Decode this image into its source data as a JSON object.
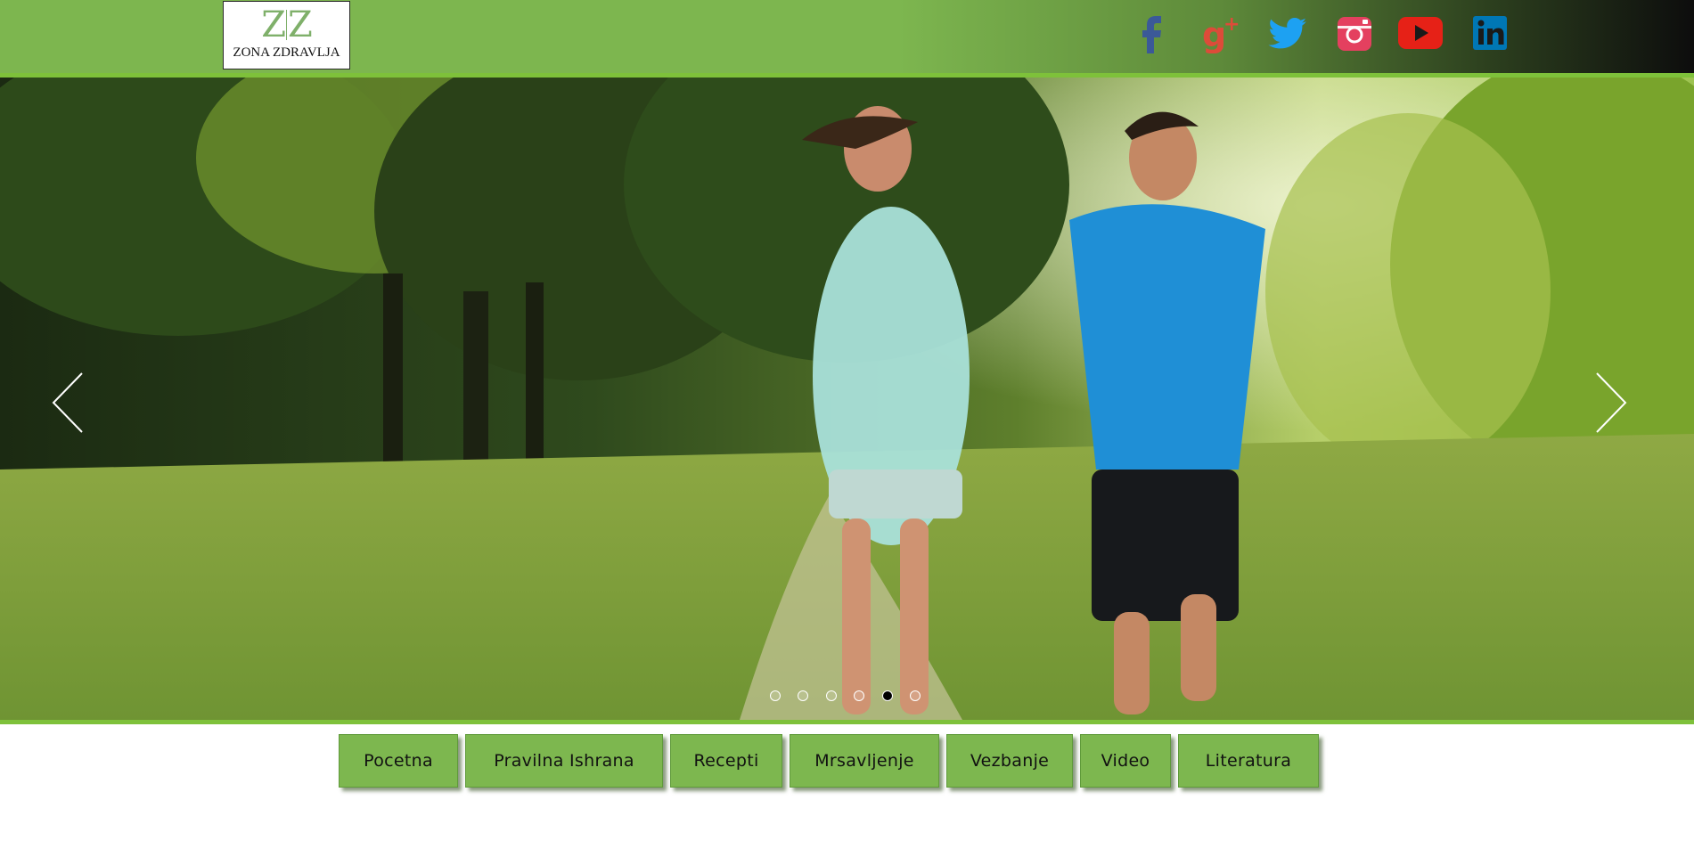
{
  "header": {
    "logo": {
      "mark": "Z|Z",
      "mark_left": "Z",
      "mark_right": "Z",
      "text": "ZONA ZDRAVLJA"
    },
    "social": [
      {
        "name": "facebook",
        "icon": "facebook-icon",
        "color": "#3b5998"
      },
      {
        "name": "google-plus",
        "icon": "google-plus-icon",
        "color": "#dd4b39"
      },
      {
        "name": "twitter",
        "icon": "twitter-icon",
        "color": "#1da1f2"
      },
      {
        "name": "instagram",
        "icon": "instagram-icon",
        "color": "#e4405f"
      },
      {
        "name": "youtube",
        "icon": "youtube-icon",
        "color": "#e62117"
      },
      {
        "name": "linkedin",
        "icon": "linkedin-icon",
        "color": "#0077b5"
      }
    ]
  },
  "carousel": {
    "image": "two-runners-in-park-photo",
    "prev_icon": "chevron-left-icon",
    "next_icon": "chevron-right-icon",
    "slide_count": 6,
    "active_slide": 5
  },
  "nav": {
    "items": [
      {
        "label": "Pocetna"
      },
      {
        "label": "Pravilna Ishrana"
      },
      {
        "label": "Recepti"
      },
      {
        "label": "Mrsavljenje"
      },
      {
        "label": "Vezbanje"
      },
      {
        "label": "Video"
      },
      {
        "label": "Literatura"
      }
    ]
  },
  "colors": {
    "brand_green": "#7db64f",
    "accent_line": "#7ec13a"
  }
}
